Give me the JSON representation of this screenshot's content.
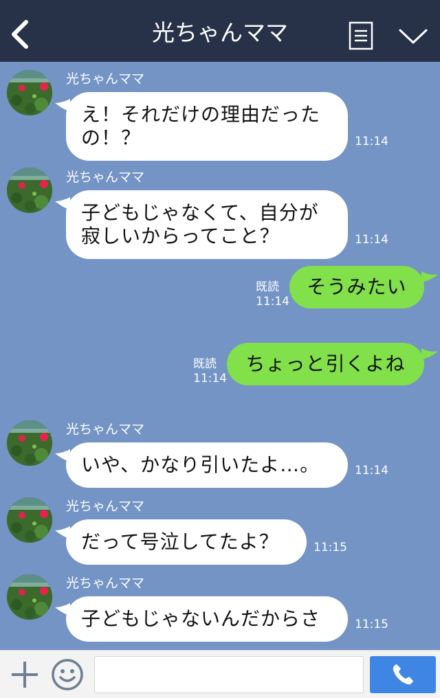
{
  "header": {
    "title": "光ちゃんママ",
    "back_icon": "chevron-left-icon",
    "menu_icon": "list-icon",
    "collapse_icon": "chevron-down-icon"
  },
  "messages": [
    {
      "direction": "incoming",
      "sender": "光ちゃんママ",
      "lines": [
        "え！それだけの理由だった",
        "の！？"
      ],
      "time": "11:14"
    },
    {
      "direction": "incoming",
      "sender": "光ちゃんママ",
      "lines": [
        "子どもじゃなくて、自分が",
        "寂しいからってこと？"
      ],
      "time": "11:14"
    },
    {
      "direction": "outgoing",
      "read": "既読",
      "text": "そうみたい",
      "time": "11:14"
    },
    {
      "direction": "outgoing",
      "read": "既読",
      "text": "ちょっと引くよね",
      "time": "11:14"
    },
    {
      "direction": "incoming",
      "sender": "光ちゃんママ",
      "text": "いや、かなり引いたよ…。",
      "time": "11:14"
    },
    {
      "direction": "incoming",
      "sender": "光ちゃんママ",
      "text": "だって号泣してたよ？",
      "time": "11:15"
    },
    {
      "direction": "incoming",
      "sender": "光ちゃんママ",
      "text": "子どもじゃないんだからさ",
      "time": "11:15"
    }
  ],
  "footer": {
    "input_value": "",
    "plus_icon": "plus-icon",
    "emoji_icon": "smiley-icon",
    "call_icon": "phone-icon"
  },
  "colors": {
    "header_bg": "#273248",
    "chat_bg": "#7394c5",
    "outgoing_bubble": "#82e04a",
    "incoming_bubble": "#ffffff",
    "call_button": "#3f86e4"
  }
}
